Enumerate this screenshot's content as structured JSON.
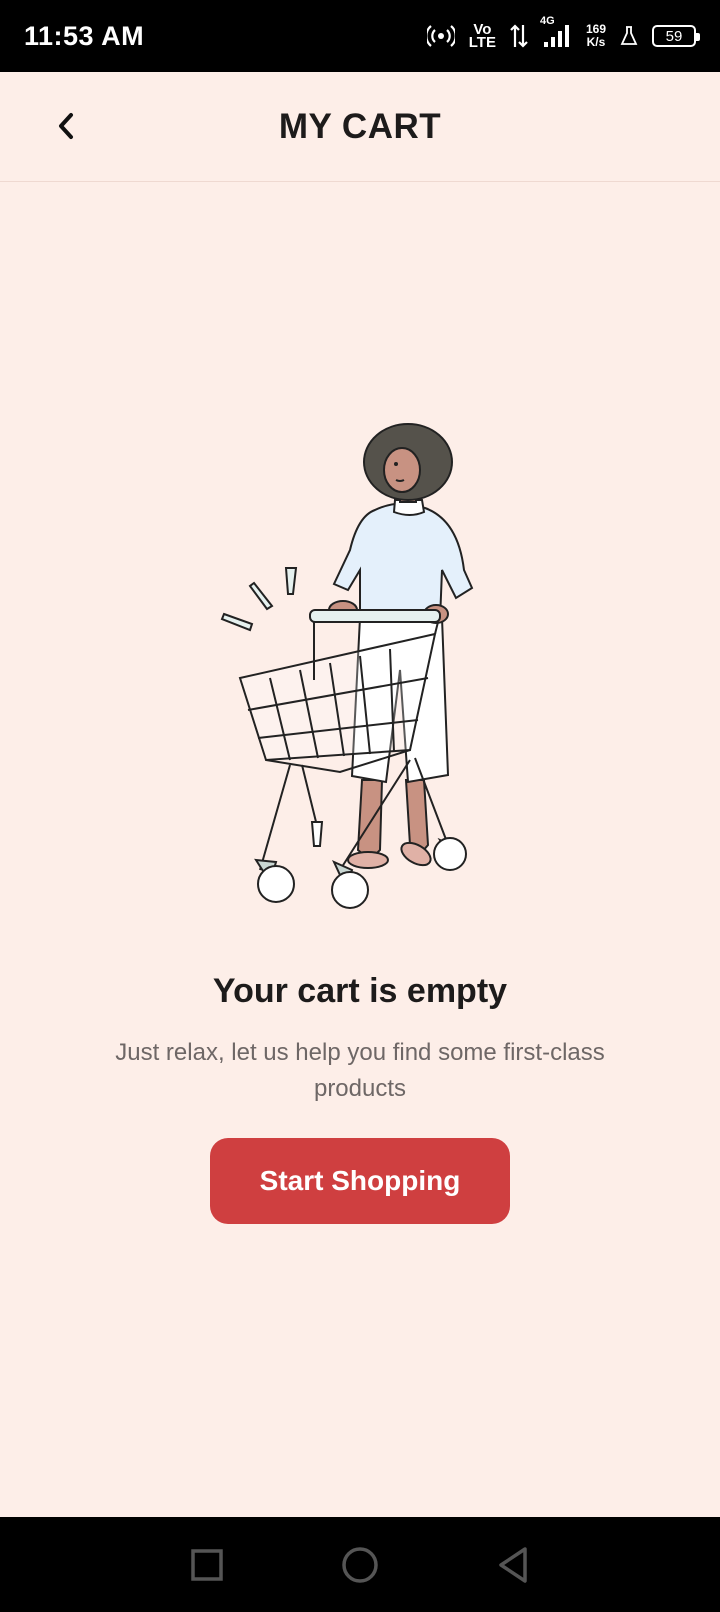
{
  "status_bar": {
    "time": "11:53 AM",
    "network_top": "Vo",
    "network_bottom": "LTE",
    "signal_label": "4G",
    "speed_value": "169",
    "speed_unit": "K/s",
    "battery": "59"
  },
  "header": {
    "title": "MY CART",
    "back_icon": "chevron-left-icon"
  },
  "empty_state": {
    "title": "Your cart is empty",
    "subtitle": "Just relax, let us help you find some first-class products",
    "button_label": "Start Shopping"
  },
  "nav_bar": {
    "recents_icon": "square-icon",
    "home_icon": "circle-icon",
    "back_icon": "triangle-back-icon"
  },
  "colors": {
    "background": "#fdeee8",
    "accent": "#cf3f40",
    "title_text": "#1d1b1b",
    "subtitle_text": "#6e6766"
  }
}
